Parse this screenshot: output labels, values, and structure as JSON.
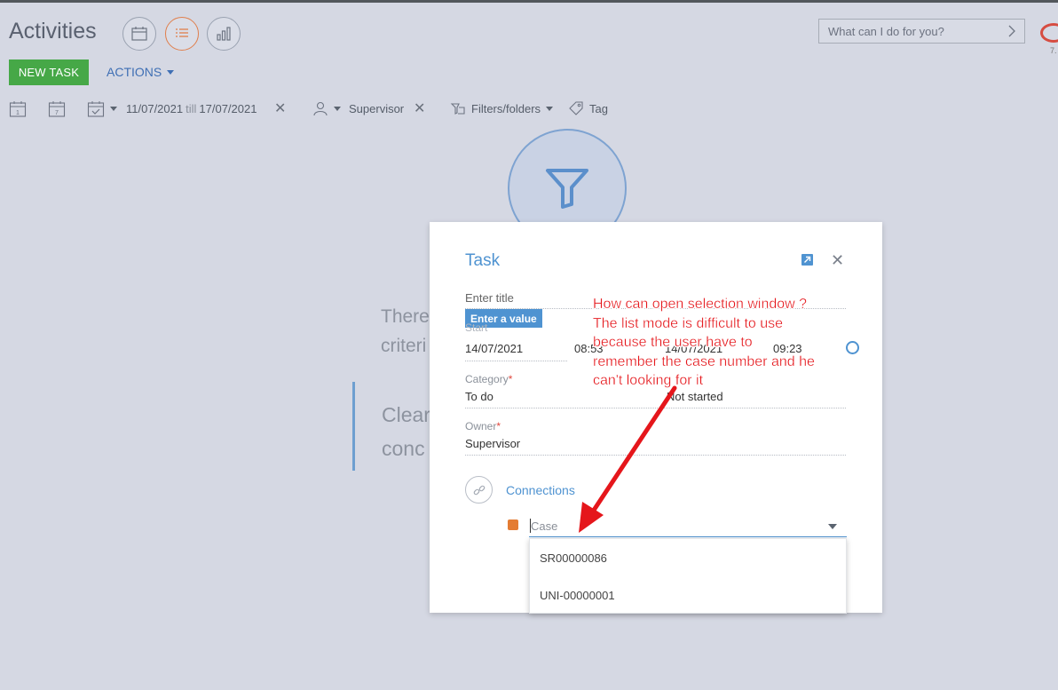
{
  "header": {
    "title": "Activities",
    "view_buttons": [
      {
        "name": "calendar-view",
        "icon": "calendar-icon",
        "active": false
      },
      {
        "name": "list-view",
        "icon": "list-icon",
        "active": true
      },
      {
        "name": "analytics-view",
        "icon": "bar-chart-icon",
        "active": false
      }
    ],
    "search_placeholder": "What can I do for you?",
    "version_text": "7."
  },
  "toolbar": {
    "new_task_label": "NEW TASK",
    "actions_label": "ACTIONS"
  },
  "filters": {
    "date_from": "11/07/2021",
    "till_word": "till",
    "date_to": "17/07/2021",
    "owner": "Supervisor",
    "filters_folders_label": "Filters/folders",
    "tag_label": "Tag"
  },
  "background": {
    "empty_line1": "There",
    "empty_line2": "criteri",
    "empty_line3": "Clear",
    "empty_line4": "conc"
  },
  "task_modal": {
    "title": "Task",
    "title_placeholder": "Enter title",
    "hint_badge": "Enter a value",
    "start_label": "Start",
    "start_date": "14/07/2021",
    "start_time": "08:53",
    "due_date": "14/07/2021",
    "due_time": "09:23",
    "category_label": "Category",
    "category_value": "To do",
    "status_value": "Not started",
    "owner_label": "Owner",
    "owner_value": "Supervisor",
    "connections_label": "Connections",
    "case_placeholder": "Case",
    "case_options": [
      "SR00000086",
      "UNI-00000001"
    ]
  },
  "annotation": {
    "lines": [
      "How can open selection window ?",
      "The list mode is difficult to use",
      "because the user have to",
      "remember the case number and he",
      "can't looking for it"
    ],
    "color": "#e5161b"
  },
  "colors": {
    "accent_blue": "#4f93d1",
    "new_task_green": "#46a847",
    "active_view_orange": "#e07f4c",
    "required_red": "#e0473d"
  }
}
